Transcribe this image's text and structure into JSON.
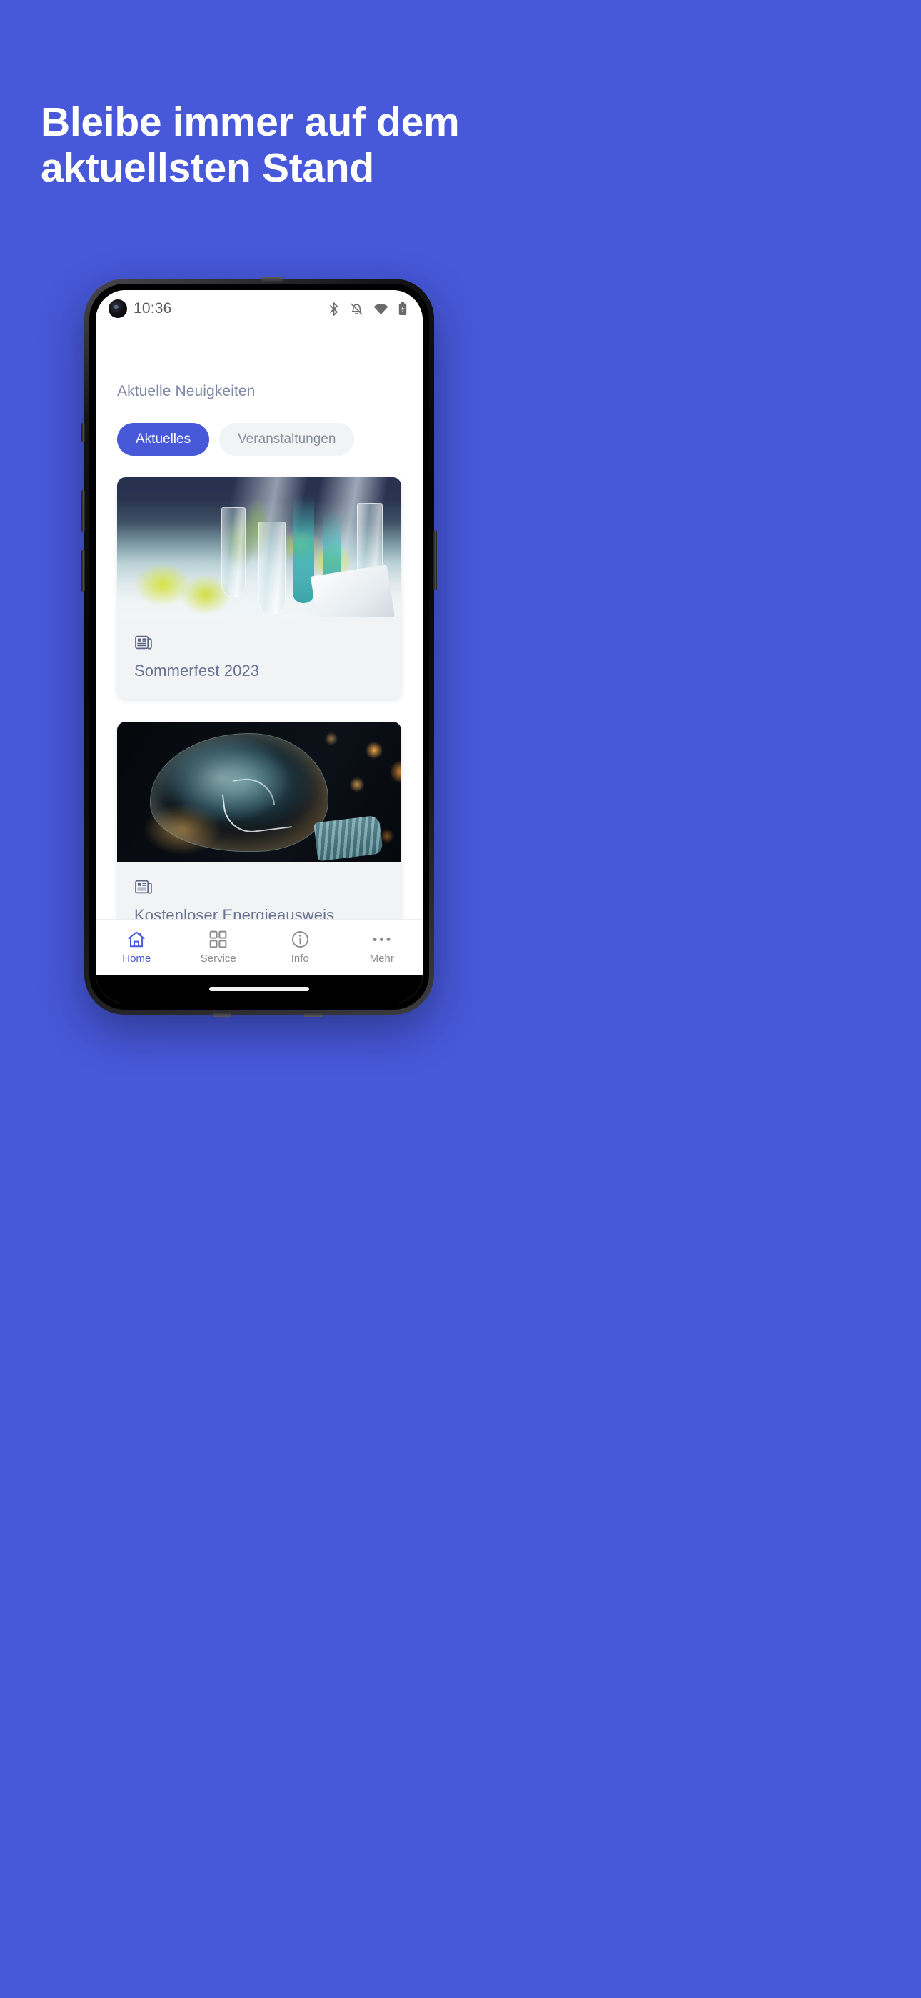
{
  "promo": {
    "headline": "Bleibe immer auf dem\naktuellsten Stand",
    "background_color": "#4758D8",
    "headline_color": "#FFFFFF"
  },
  "phone": {
    "status_bar": {
      "time": "10:36",
      "icons": [
        "bluetooth-icon",
        "bell-off-icon",
        "wifi-icon",
        "battery-charging-icon"
      ]
    },
    "gesture_bar": "home-indicator"
  },
  "app": {
    "section_title": "Aktuelle Neuigkeiten",
    "filters": [
      {
        "label": "Aktuelles",
        "active": true
      },
      {
        "label": "Veranstaltungen",
        "active": false
      }
    ],
    "cards": [
      {
        "title": "Sommerfest 2023",
        "icon": "newspaper-icon",
        "image_alt": "festlich gedeckter Tisch mit Gläsern und gelben Blumen"
      },
      {
        "title": "Kostenloser Energieausweis",
        "icon": "newspaper-icon",
        "image_alt": "Glühbirne mit Glühfaden vor Bokeh-Lichtern"
      }
    ],
    "nav": [
      {
        "label": "Home",
        "icon": "home-icon",
        "active": true
      },
      {
        "label": "Service",
        "icon": "grid-icon",
        "active": false
      },
      {
        "label": "Info",
        "icon": "info-icon",
        "active": false
      },
      {
        "label": "Mehr",
        "icon": "ellipsis-icon",
        "active": false
      }
    ]
  },
  "colors": {
    "brand_blue": "#4758D8",
    "card_surface": "#F2F3F5",
    "muted_text": "#7C85A3",
    "card_title_text": "#6A7392",
    "nav_idle": "#8B8B8B"
  }
}
